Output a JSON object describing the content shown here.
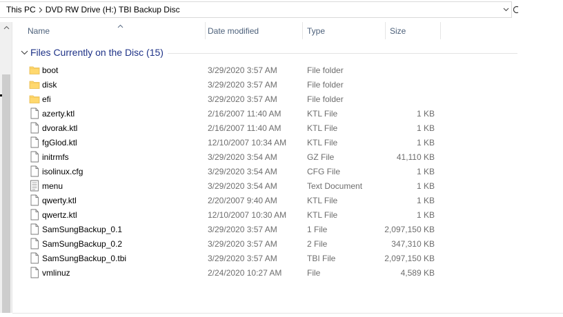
{
  "address": {
    "crumbs": [
      "This PC",
      "DVD RW Drive (H:) TBI Backup Disc"
    ],
    "separator_icon": "chevron-right-icon",
    "dropdown_icon": "chevron-down-icon"
  },
  "columns": {
    "name": "Name",
    "date": "Date modified",
    "type": "Type",
    "size": "Size",
    "sort_icon": "caret-up-icon"
  },
  "group": {
    "title": "Files Currently on the Disc (15)",
    "chevron_icon": "chevron-down-icon"
  },
  "files": [
    {
      "name": "boot",
      "date": "3/29/2020 3:57 AM",
      "type": "File folder",
      "size": "",
      "icon": "folder-icon"
    },
    {
      "name": "disk",
      "date": "3/29/2020 3:57 AM",
      "type": "File folder",
      "size": "",
      "icon": "folder-icon"
    },
    {
      "name": "efi",
      "date": "3/29/2020 3:57 AM",
      "type": "File folder",
      "size": "",
      "icon": "folder-icon"
    },
    {
      "name": "azerty.ktl",
      "date": "2/16/2007 11:40 AM",
      "type": "KTL File",
      "size": "1 KB",
      "icon": "file-icon"
    },
    {
      "name": "dvorak.ktl",
      "date": "2/16/2007 11:40 AM",
      "type": "KTL File",
      "size": "1 KB",
      "icon": "file-icon"
    },
    {
      "name": "fgGlod.ktl",
      "date": "12/10/2007 10:34 AM",
      "type": "KTL File",
      "size": "1 KB",
      "icon": "file-icon"
    },
    {
      "name": "initrmfs",
      "date": "3/29/2020 3:54 AM",
      "type": "GZ File",
      "size": "41,110 KB",
      "icon": "file-icon"
    },
    {
      "name": "isolinux.cfg",
      "date": "3/29/2020 3:54 AM",
      "type": "CFG File",
      "size": "1 KB",
      "icon": "file-icon"
    },
    {
      "name": "menu",
      "date": "3/29/2020 3:54 AM",
      "type": "Text Document",
      "size": "1 KB",
      "icon": "text-document-icon"
    },
    {
      "name": "qwerty.ktl",
      "date": "2/20/2007 9:40 AM",
      "type": "KTL File",
      "size": "1 KB",
      "icon": "file-icon"
    },
    {
      "name": "qwertz.ktl",
      "date": "12/10/2007 10:30 AM",
      "type": "KTL File",
      "size": "1 KB",
      "icon": "file-icon"
    },
    {
      "name": "SamSungBackup_0.1",
      "date": "3/29/2020 3:57 AM",
      "type": "1 File",
      "size": "2,097,150 KB",
      "icon": "file-icon"
    },
    {
      "name": "SamSungBackup_0.2",
      "date": "3/29/2020 3:57 AM",
      "type": "2 File",
      "size": "347,310 KB",
      "icon": "file-icon"
    },
    {
      "name": "SamSungBackup_0.tbi",
      "date": "3/29/2020 3:57 AM",
      "type": "TBI File",
      "size": "2,097,150 KB",
      "icon": "file-icon"
    },
    {
      "name": "vmlinuz",
      "date": "2/24/2020 10:27 AM",
      "type": "File",
      "size": "4,589 KB",
      "icon": "file-icon"
    }
  ],
  "colors": {
    "folder": "#ffd86e",
    "header_text": "#4c607a",
    "group_title": "#1e3287",
    "secondary_text": "#6d6d6d"
  }
}
